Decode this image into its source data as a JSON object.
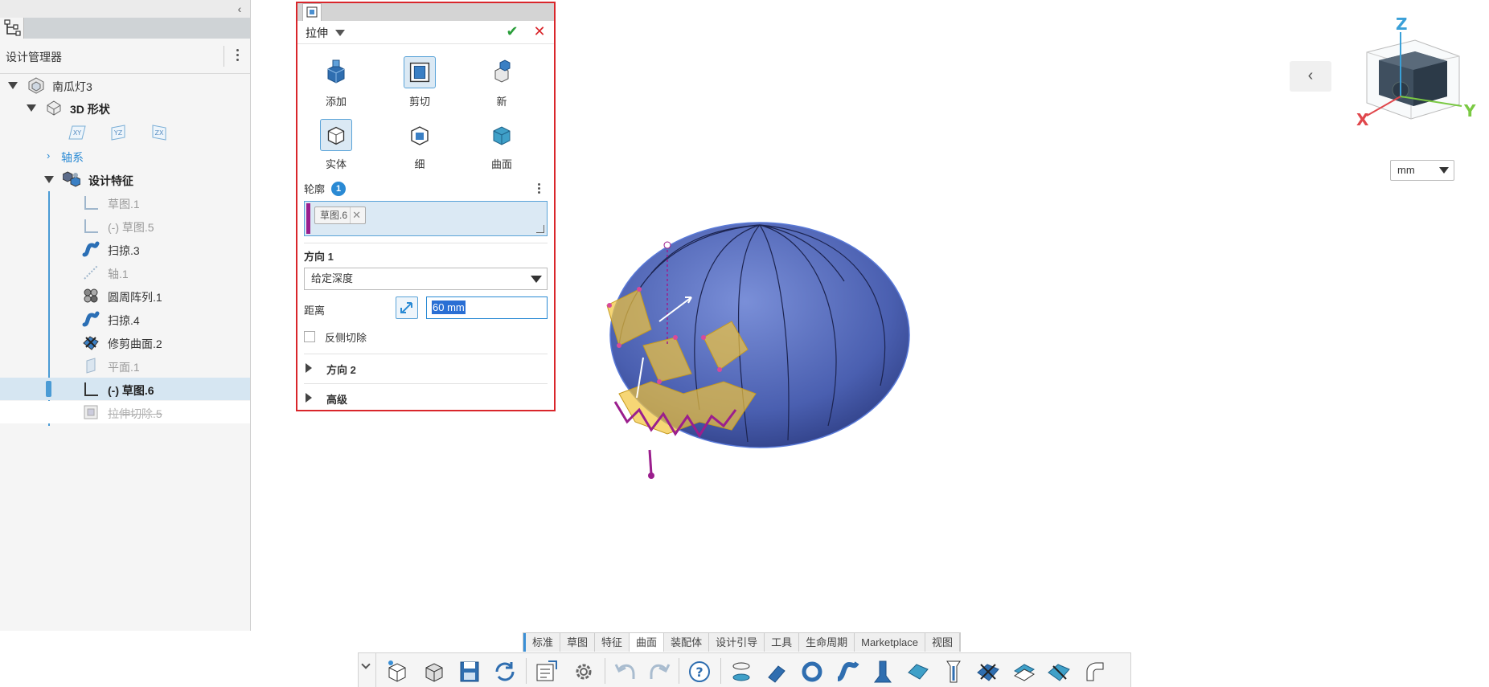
{
  "left_panel": {
    "title": "设计管理器",
    "tree": [
      {
        "label": "南瓜灯3",
        "style": "normal"
      },
      {
        "label": "3D 形状",
        "style": "bold"
      },
      {
        "label": "轴系",
        "style": "link"
      },
      {
        "label": "设计特征",
        "style": "bold"
      },
      {
        "label": "草图.1",
        "style": "muted"
      },
      {
        "label": "(-)  草图.5",
        "style": "muted"
      },
      {
        "label": "扫掠.3",
        "style": "normal"
      },
      {
        "label": "轴.1",
        "style": "muted"
      },
      {
        "label": "圆周阵列.1",
        "style": "normal"
      },
      {
        "label": "扫掠.4",
        "style": "normal"
      },
      {
        "label": "修剪曲面.2",
        "style": "normal"
      },
      {
        "label": "平面.1",
        "style": "muted"
      },
      {
        "label": "(-)  草图.6",
        "style": "bold"
      },
      {
        "label": "拉伸切除.5",
        "style": "strike"
      }
    ],
    "planes": [
      "XY",
      "YZ",
      "ZX"
    ]
  },
  "extrude": {
    "title": "拉伸",
    "ops": [
      {
        "label": "添加",
        "active": false
      },
      {
        "label": "剪切",
        "active": true
      },
      {
        "label": "新",
        "active": false
      }
    ],
    "types": [
      {
        "label": "实体",
        "active": true
      },
      {
        "label": "细",
        "active": false
      },
      {
        "label": "曲面",
        "active": false
      }
    ],
    "profile_label": "轮廓",
    "profile_count": "1",
    "profile_chip": "草图.6",
    "direction1_label": "方向 1",
    "direction1_value": "给定深度",
    "distance_label": "距离",
    "distance_value": "60 mm",
    "reverse_cut_label": "反侧切除",
    "direction2_label": "方向 2",
    "advanced_label": "高级"
  },
  "viewcube": {
    "x": "X",
    "y": "Y",
    "z": "Z"
  },
  "unit": "mm",
  "command_tabs": [
    "标准",
    "草图",
    "特征",
    "曲面",
    "装配体",
    "设计引导",
    "工具",
    "生命周期",
    "Marketplace",
    "视图"
  ],
  "active_tab": "曲面",
  "colors": {
    "accent": "#2a8ad4",
    "panel_border": "#d9262b",
    "pumpkin": "#4a5fb0",
    "sketch": "#9b1e8d",
    "feature": "#f2c43a"
  }
}
